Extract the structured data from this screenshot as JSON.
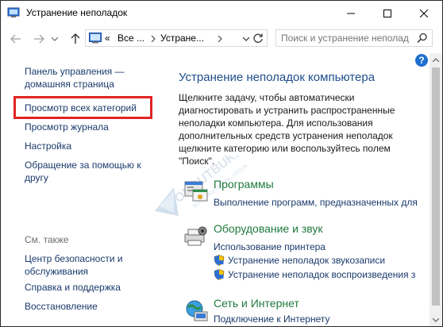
{
  "window": {
    "title": "Устранение неполадок"
  },
  "address": {
    "overflow": "«",
    "crumbs": [
      "Все ...",
      "Устране..."
    ]
  },
  "search": {
    "placeholder": "Поиск и устранение неполад..."
  },
  "help": {
    "label": "?"
  },
  "left_nav": {
    "home_line1": "Панель управления —",
    "home_line2": "домашняя страница",
    "view_all": "Просмотр всех категорий",
    "history": "Просмотр журнала",
    "settings": "Настройка",
    "friend_line1": "Обращение за помощью к",
    "friend_line2": "другу",
    "see_also": "См. также",
    "security_line1": "Центр безопасности и",
    "security_line2": "обслуживания",
    "help_support": "Справка и поддержка",
    "recovery": "Восстановление"
  },
  "main": {
    "heading": "Устранение неполадок компьютера",
    "intro": [
      "Щелкните задачу, чтобы автоматически",
      "диагностировать и устранить распространенные",
      "неполадки компьютера. Для использования",
      "дополнительных средств устранения неполадок",
      "щелкните категорию или воспользуйтесь полем",
      "\"Поиск\"."
    ],
    "categories": [
      {
        "title": "Программы",
        "icon": "programs-icon",
        "link": "Выполнение программ, предназначенных для"
      },
      {
        "title": "Оборудование и звук",
        "icon": "hardware-sound-icon",
        "link": "Использование принтера",
        "sub_links": [
          "Устранение неполадок звукозаписи",
          "Устранение неполадок воспроизведения з"
        ]
      },
      {
        "title": "Сеть и Интернет",
        "icon": "network-icon",
        "link": "Подключение к Интернету"
      }
    ]
  },
  "watermark": {
    "text": "ONOUTBUKE",
    "subtext": "всё о ноутбуках, обсуж"
  },
  "colors": {
    "highlight": "#e02424",
    "category_title": "#1f7a3d",
    "link": "#1a3a6b",
    "heading": "#1e4e8c"
  }
}
